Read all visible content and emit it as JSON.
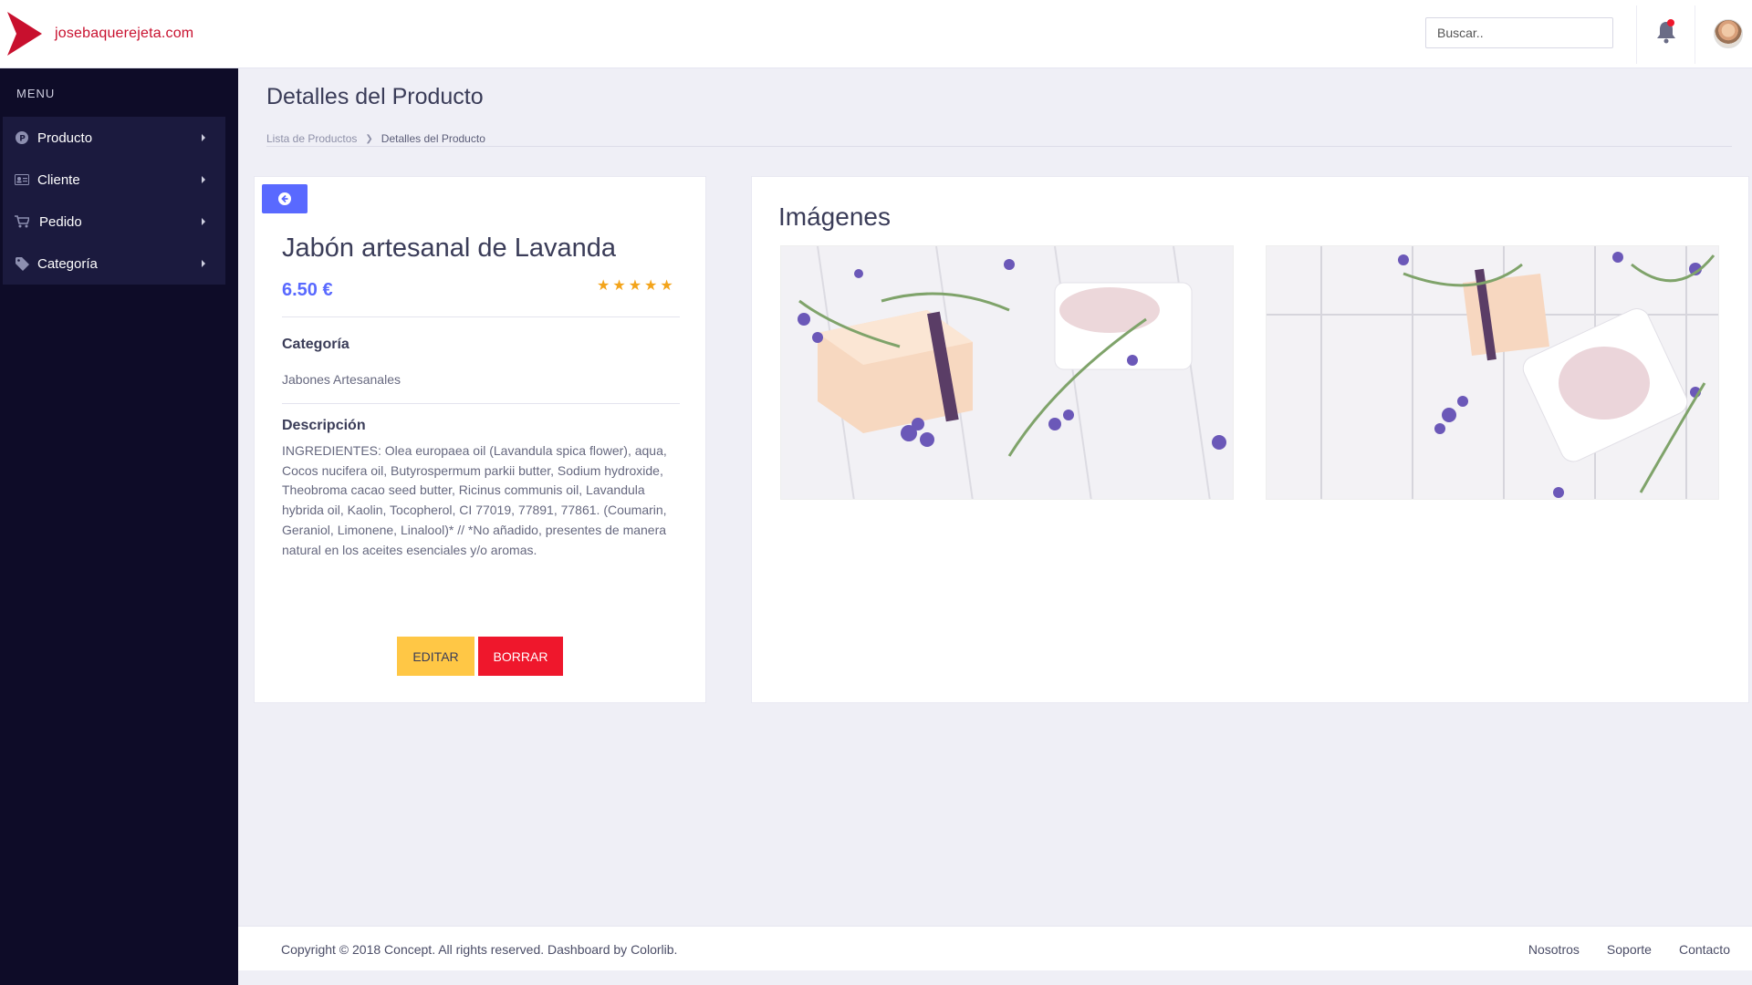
{
  "header": {
    "brand_name": "josebaquerejeta.com",
    "search_placeholder": "Buscar..",
    "brand_color": "#c8102e"
  },
  "sidebar": {
    "menu_title": "MENU",
    "items": [
      {
        "label": "Producto",
        "icon": "product-icon"
      },
      {
        "label": "Cliente",
        "icon": "id-card-icon"
      },
      {
        "label": "Pedido",
        "icon": "cart-icon"
      },
      {
        "label": "Categoría",
        "icon": "tag-icon"
      }
    ]
  },
  "page": {
    "title": "Detalles del Producto",
    "breadcrumb": [
      "Lista de Productos",
      "Detalles del Producto"
    ]
  },
  "product": {
    "name": "Jabón artesanal de Lavanda",
    "price": "6.50 €",
    "rating": 5,
    "category_label": "Categoría",
    "category_value": "Jabones Artesanales",
    "description_label": "Descripción",
    "description": "INGREDIENTES: Olea europaea oil (Lavandula spica flower), aqua, Cocos nucifera oil, Butyrospermum parkii butter, Sodium hydroxide, Theobroma cacao seed butter, Ricinus communis oil, Lavandula hybrida oil, Kaolin, Tocopherol, CI 77019, 77891, 77861. (Coumarin, Geraniol, Limonene, Linalool)* // *No añadido, presentes de manera natural en los aceites esenciales y/o aromas.",
    "edit_label": "EDITAR",
    "delete_label": "BORRAR",
    "accent_color": "#5969ff",
    "edit_color": "#ffc745",
    "delete_color": "#ef172c",
    "star_color": "#f3a41b"
  },
  "images": {
    "title": "Imágenes"
  },
  "footer": {
    "copyright": "Copyright © 2018 Concept. All rights reserved. Dashboard by Colorlib.",
    "links": [
      "Nosotros",
      "Soporte",
      "Contacto"
    ]
  }
}
